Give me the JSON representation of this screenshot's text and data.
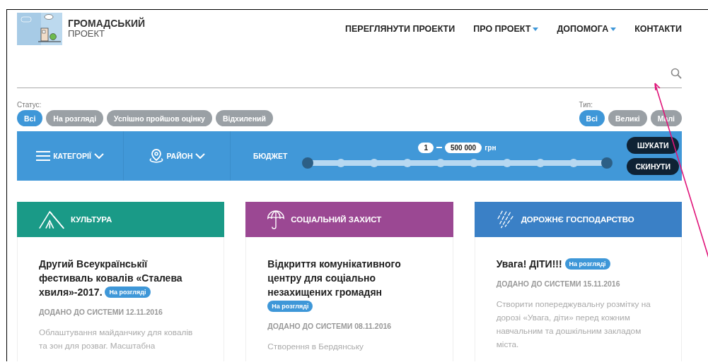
{
  "logo": {
    "title": "ГРОМАДСЬКИЙ",
    "subtitle": "ПРОЕКТ"
  },
  "nav": [
    {
      "label": "ПЕРЕГЛЯНУТИ ПРОЕКТИ",
      "has_menu": false
    },
    {
      "label": "ПРО ПРОЕКТ",
      "has_menu": true
    },
    {
      "label": "ДОПОМОГА",
      "has_menu": true
    },
    {
      "label": "КОНТАКТИ",
      "has_menu": false
    }
  ],
  "status_filter": {
    "label": "Статус:",
    "options": [
      {
        "label": "Всі",
        "selected": true
      },
      {
        "label": "На розгляді",
        "selected": false
      },
      {
        "label": "Успішно пройшов оцінку",
        "selected": false
      },
      {
        "label": "Відхилений",
        "selected": false
      }
    ]
  },
  "type_filter": {
    "label": "Тип:",
    "options": [
      {
        "label": "Всі",
        "selected": true
      },
      {
        "label": "Великі",
        "selected": false
      },
      {
        "label": "Малі",
        "selected": false
      }
    ]
  },
  "filter_bar": {
    "categories": "КАТЕГОРІЇ",
    "district": "РАЙОН",
    "budget": "БЮДЖЕТ",
    "budget_from": "1",
    "budget_to": "500 000",
    "currency": "грн",
    "slider": {
      "level": 1
    },
    "buttons": [
      "ШУКАТИ",
      "СКИНУТИ"
    ]
  },
  "cards": [
    {
      "kind": "culture",
      "category": "КУЛЬТУРА",
      "color": "#1a9a87",
      "title": "Другий Всеукраїнськії фестиваль ковалів «Сталева хвиля»-2017.",
      "badge": "На розгляді",
      "date": "ДОДАНО ДО СИСТЕМИ 12.11.2016",
      "description": "Облаштування майданчику для ковалів та зон для розваг. Масштабна"
    },
    {
      "kind": "social",
      "category": "СОЦІАЛЬНИЙ ЗАХИСТ",
      "color": "#9b4893",
      "title": "Відкриття комунікативного центру для соціально незахищених громадян",
      "badge": "На розгляді",
      "date": "ДОДАНО ДО СИСТЕМИ 08.11.2016",
      "description": "Створення в Бердянську"
    },
    {
      "kind": "roads",
      "category": "ДОРОЖНЄ ГОСПОДАРСТВО",
      "color": "#3a80c6",
      "title": "Увага! ДІТИ!!!",
      "badge": "На розгляді",
      "date": "ДОДАНО ДО СИСТЕМИ 15.11.2016",
      "description": "Створити попереджувальну розмітку на дорозі «Увага, діти» перед кожним навчальним та дошкільним закладом міста."
    }
  ]
}
